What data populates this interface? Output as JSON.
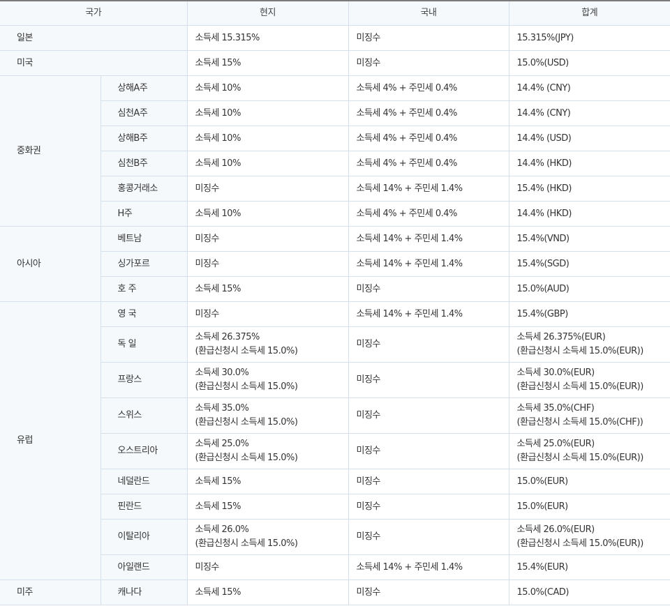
{
  "headers": [
    "국가",
    "현지",
    "국내",
    "합계"
  ],
  "groups": [
    {
      "name": "일본",
      "rows": [
        {
          "sub": "",
          "local": [
            "소득세 15.315%"
          ],
          "domestic": "미징수",
          "total": [
            "15.315%(JPY)"
          ]
        }
      ]
    },
    {
      "name": "미국",
      "rows": [
        {
          "sub": "",
          "local": [
            "소득세 15%"
          ],
          "domestic": "미징수",
          "total": [
            "15.0%(USD)"
          ]
        }
      ]
    },
    {
      "name": "중화권",
      "rows": [
        {
          "sub": "상해A주",
          "local": [
            "소득세 10%"
          ],
          "domestic": "소득세 4% + 주민세 0.4%",
          "total": [
            "14.4% (CNY)"
          ]
        },
        {
          "sub": "심천A주",
          "local": [
            "소득세 10%"
          ],
          "domestic": "소득세 4% + 주민세 0.4%",
          "total": [
            "14.4% (CNY)"
          ]
        },
        {
          "sub": "상해B주",
          "local": [
            "소득세 10%"
          ],
          "domestic": "소득세 4% + 주민세 0.4%",
          "total": [
            "14.4% (USD)"
          ]
        },
        {
          "sub": "심천B주",
          "local": [
            "소득세 10%"
          ],
          "domestic": "소득세 4% + 주민세 0.4%",
          "total": [
            "14.4% (HKD)"
          ]
        },
        {
          "sub": "홍콩거래소",
          "local": [
            "미징수"
          ],
          "domestic": "소득세 14% + 주민세 1.4%",
          "total": [
            "15.4% (HKD)"
          ]
        },
        {
          "sub": "H주",
          "local": [
            "소득세 10%"
          ],
          "domestic": "소득세 4% + 주민세 0.4%",
          "total": [
            "14.4% (HKD)"
          ]
        }
      ]
    },
    {
      "name": "아시아",
      "rows": [
        {
          "sub": "베트남",
          "local": [
            "미징수"
          ],
          "domestic": "소득세 14% + 주민세 1.4%",
          "total": [
            "15.4%(VND)"
          ]
        },
        {
          "sub": "싱가포르",
          "local": [
            "미징수"
          ],
          "domestic": "소득세 14% + 주민세 1.4%",
          "total": [
            "15.4%(SGD)"
          ]
        },
        {
          "sub": "호 주",
          "local": [
            "소득세 15%"
          ],
          "domestic": "미징수",
          "total": [
            "15.0%(AUD)"
          ]
        }
      ]
    },
    {
      "name": "유럽",
      "rows": [
        {
          "sub": "영 국",
          "local": [
            "미징수"
          ],
          "domestic": "소득세 14% + 주민세 1.4%",
          "total": [
            "15.4%(GBP)"
          ]
        },
        {
          "sub": "독 일",
          "local": [
            "소득세 26.375%",
            "(환급신청시 소득세 15.0%)"
          ],
          "domestic": "미징수",
          "total": [
            "소득세 26.375%(EUR)",
            "(환급신청시 소득세 15.0%(EUR))"
          ]
        },
        {
          "sub": "프랑스",
          "local": [
            "소득세 30.0%",
            "(환급신청시 소득세 15.0%)"
          ],
          "domestic": "미징수",
          "total": [
            "소득세 30.0%(EUR)",
            "(환급신청시 소득세 15.0%(EUR))"
          ]
        },
        {
          "sub": "스위스",
          "local": [
            "소득세 35.0%",
            "(환급신청시 소득세 15.0%)"
          ],
          "domestic": "미징수",
          "total": [
            "소득세 35.0%(CHF)",
            "(환급신청시 소득세 15.0%(CHF))"
          ]
        },
        {
          "sub": "오스트리아",
          "local": [
            "소득세 25.0%",
            "(환급신청시 소득세 15.0%)"
          ],
          "domestic": "미징수",
          "total": [
            "소득세 25.0%(EUR)",
            "(환급신청시 소득세 15.0%(EUR))"
          ]
        },
        {
          "sub": "네덜란드",
          "local": [
            "소득세 15%"
          ],
          "domestic": "미징수",
          "total": [
            "15.0%(EUR)"
          ]
        },
        {
          "sub": "핀란드",
          "local": [
            "소득세 15%"
          ],
          "domestic": "미징수",
          "total": [
            "15.0%(EUR)"
          ]
        },
        {
          "sub": "이탈리아",
          "local": [
            "소득세 26.0%",
            "(환급신청시 소득세 15.0%)"
          ],
          "domestic": "미징수",
          "total": [
            "소득세 26.0%(EUR)",
            "(환급신청시 소득세 15.0%(EUR))"
          ]
        },
        {
          "sub": "아일랜드",
          "local": [
            "미징수"
          ],
          "domestic": "소득세 14% + 주민세 1.4%",
          "total": [
            "15.4%(EUR)"
          ]
        }
      ]
    },
    {
      "name": "미주",
      "rows": [
        {
          "sub": "캐나다",
          "local": [
            "소득세 15%"
          ],
          "domestic": "미징수",
          "total": [
            "15.0%(CAD)"
          ]
        }
      ]
    }
  ]
}
